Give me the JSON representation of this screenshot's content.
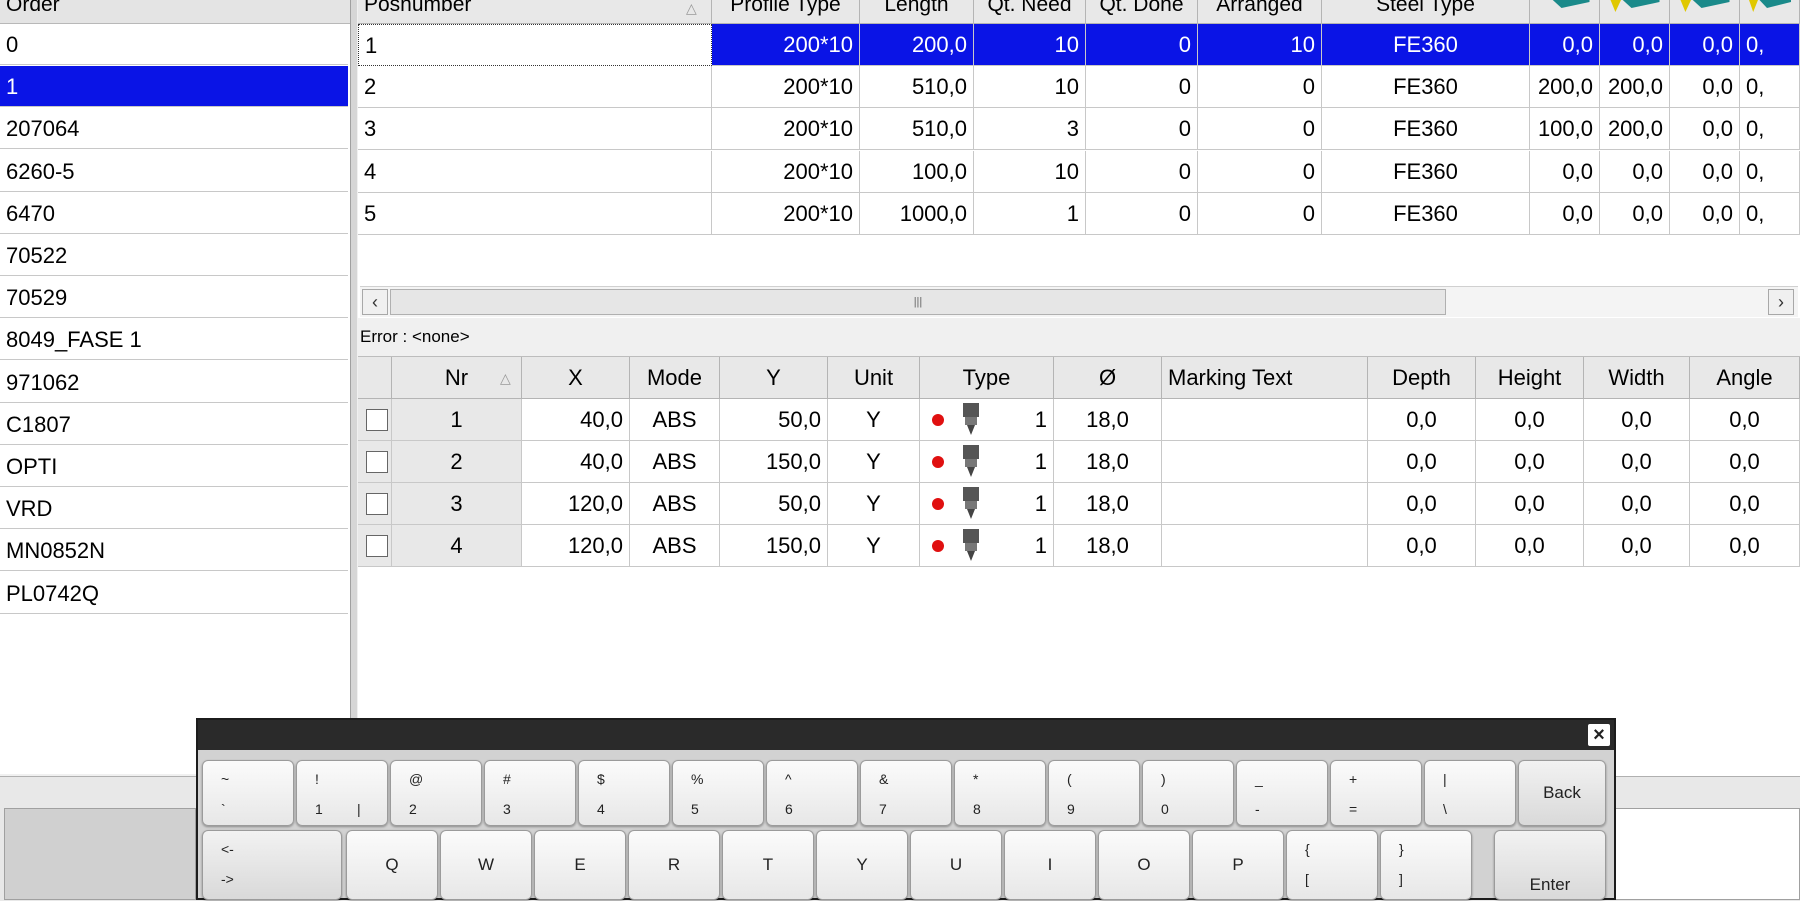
{
  "order_list": {
    "header": "Order",
    "items": [
      "0",
      "1",
      "207064",
      "6260-5",
      "6470",
      "70522",
      "70529",
      "8049_FASE 1",
      "971062",
      "C1807",
      "OPTI",
      "VRD",
      "MN0852N",
      "PL0742Q"
    ],
    "selected_index": 1
  },
  "pos_grid": {
    "columns": [
      "Posnumber",
      "Profile Type",
      "Length",
      "Qt. Need",
      "Qt. Done",
      "Arranged",
      "Steel Type"
    ],
    "rows": [
      {
        "posnumber": "1",
        "profile": "200*10",
        "length": "200,0",
        "need": "10",
        "done": "0",
        "arranged": "10",
        "steel": "FE360",
        "v1": "0,0",
        "v2": "0,0",
        "v3": "0,0",
        "v4": "0,"
      },
      {
        "posnumber": "2",
        "profile": "200*10",
        "length": "510,0",
        "need": "10",
        "done": "0",
        "arranged": "0",
        "steel": "FE360",
        "v1": "200,0",
        "v2": "200,0",
        "v3": "0,0",
        "v4": "0,"
      },
      {
        "posnumber": "3",
        "profile": "200*10",
        "length": "510,0",
        "need": "3",
        "done": "0",
        "arranged": "0",
        "steel": "FE360",
        "v1": "100,0",
        "v2": "200,0",
        "v3": "0,0",
        "v4": "0,"
      },
      {
        "posnumber": "4",
        "profile": "200*10",
        "length": "100,0",
        "need": "10",
        "done": "0",
        "arranged": "0",
        "steel": "FE360",
        "v1": "0,0",
        "v2": "0,0",
        "v3": "0,0",
        "v4": "0,"
      },
      {
        "posnumber": "5",
        "profile": "200*10",
        "length": "1000,0",
        "need": "1",
        "done": "0",
        "arranged": "0",
        "steel": "FE360",
        "v1": "0,0",
        "v2": "0,0",
        "v3": "0,0",
        "v4": "0,"
      }
    ],
    "selected_index": 0,
    "sort_indicator": "△",
    "scroll_grip": "|||"
  },
  "error_text": "Error : <none>",
  "holes_grid": {
    "columns": [
      "Nr",
      "X",
      "Mode",
      "Y",
      "Unit",
      "Type",
      "Ø",
      "Marking Text",
      "Depth",
      "Height",
      "Width",
      "Angle"
    ],
    "sort_indicator": "△",
    "rows": [
      {
        "nr": "1",
        "x": "40,0",
        "mode": "ABS",
        "y": "50,0",
        "unit": "Y",
        "type": "1",
        "dia": "18,0",
        "marking": "",
        "depth": "0,0",
        "height": "0,0",
        "width": "0,0",
        "angle": "0,0"
      },
      {
        "nr": "2",
        "x": "40,0",
        "mode": "ABS",
        "y": "150,0",
        "unit": "Y",
        "type": "1",
        "dia": "18,0",
        "marking": "",
        "depth": "0,0",
        "height": "0,0",
        "width": "0,0",
        "angle": "0,0"
      },
      {
        "nr": "3",
        "x": "120,0",
        "mode": "ABS",
        "y": "50,0",
        "unit": "Y",
        "type": "1",
        "dia": "18,0",
        "marking": "",
        "depth": "0,0",
        "height": "0,0",
        "width": "0,0",
        "angle": "0,0"
      },
      {
        "nr": "4",
        "x": "120,0",
        "mode": "ABS",
        "y": "150,0",
        "unit": "Y",
        "type": "1",
        "dia": "18,0",
        "marking": "",
        "depth": "0,0",
        "height": "0,0",
        "width": "0,0",
        "angle": "0,0"
      }
    ]
  },
  "keyboard": {
    "close": "×",
    "row1": [
      {
        "top": "~",
        "bottom": "`"
      },
      {
        "top": "!",
        "bottom": "1",
        "extra": "|"
      },
      {
        "top": "@",
        "bottom": "2"
      },
      {
        "top": "#",
        "bottom": "3"
      },
      {
        "top": "$",
        "bottom": "4"
      },
      {
        "top": "%",
        "bottom": "5"
      },
      {
        "top": "^",
        "bottom": "6"
      },
      {
        "top": "&",
        "bottom": "7"
      },
      {
        "top": "*",
        "bottom": "8"
      },
      {
        "top": "(",
        "bottom": "9"
      },
      {
        "top": ")",
        "bottom": "0"
      },
      {
        "top": "_",
        "bottom": "-"
      },
      {
        "top": "+",
        "bottom": "="
      },
      {
        "top": "|",
        "bottom": "\\"
      }
    ],
    "back": "Back",
    "tab_top": "<-",
    "tab_bottom": "->",
    "row2": [
      "Q",
      "W",
      "E",
      "R",
      "T",
      "Y",
      "U",
      "I",
      "O",
      "P"
    ],
    "row2_extra": [
      {
        "top": "{",
        "bottom": "["
      },
      {
        "top": "}",
        "bottom": "]"
      }
    ],
    "enter": "Enter"
  },
  "colors": {
    "selection": "#0a14e6",
    "icon_teal": "#1a8a8a",
    "icon_yellow": "#e0c800",
    "dot_red": "#e01010"
  }
}
